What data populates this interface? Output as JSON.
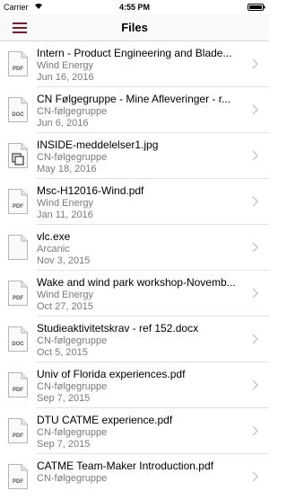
{
  "status_bar": {
    "carrier": "Carrier",
    "time": "4:55 PM"
  },
  "nav": {
    "title": "Files",
    "menu_icon": "hamburger-menu-icon",
    "accent_color": "#7a1b2c"
  },
  "files": [
    {
      "name": "Intern - Product Engineering and Blade...",
      "group": "Wind Energy",
      "date": "Jun 16, 2016",
      "type": "PDF"
    },
    {
      "name": "CN Følgegruppe - Mine Afleveringer - r...",
      "group": "CN-følgegruppe",
      "date": "Jun 6, 2016",
      "type": "DOC"
    },
    {
      "name": "INSIDE-meddelelser1.jpg",
      "group": "CN-følgegruppe",
      "date": "May 18, 2016",
      "type": "IMG"
    },
    {
      "name": "Msc-H12016-Wind.pdf",
      "group": "Wind Energy",
      "date": "Jan 11, 2016",
      "type": "PDF"
    },
    {
      "name": "vlc.exe",
      "group": "Arcanic",
      "date": "Nov 3, 2015",
      "type": ""
    },
    {
      "name": "Wake and wind park workshop-Novemb...",
      "group": "Wind Energy",
      "date": "Oct 27, 2015",
      "type": "PDF"
    },
    {
      "name": "Studieaktivitetskrav - ref 152.docx",
      "group": "CN-følgegruppe",
      "date": "Oct 5, 2015",
      "type": "DOC"
    },
    {
      "name": "Univ of Florida experiences.pdf",
      "group": "CN-følgegruppe",
      "date": "Sep 7, 2015",
      "type": "PDF"
    },
    {
      "name": "DTU CATME experience.pdf",
      "group": "CN-følgegruppe",
      "date": "Sep 7, 2015",
      "type": "PDF"
    },
    {
      "name": "CATME Team-Maker Introduction.pdf",
      "group": "CN-følgegruppe",
      "date": "",
      "type": "PDF"
    }
  ]
}
